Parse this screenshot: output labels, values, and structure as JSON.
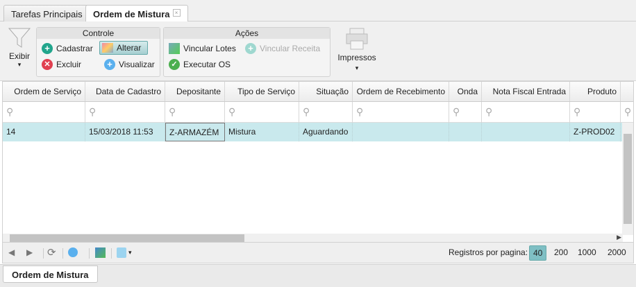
{
  "tabs": [
    {
      "label": "Tarefas Principais"
    },
    {
      "label": "Ordem de Mistura",
      "close": "×"
    }
  ],
  "toolbar": {
    "exibir": "Exibir",
    "controle": {
      "title": "Controle",
      "cadastrar": "Cadastrar",
      "alterar": "Alterar",
      "excluir": "Excluir",
      "visualizar": "Visualizar"
    },
    "acoes": {
      "title": "Ações",
      "vincular_lotes": "Vincular Lotes",
      "vincular_receita": "Vincular Receita",
      "executar_os": "Executar OS"
    },
    "impressos": "Impressos",
    "caret": "▾"
  },
  "grid": {
    "columns": [
      "Ordem de Serviço",
      "Data de Cadastro",
      "Depositante",
      "Tipo de Serviço",
      "Situação",
      "Ordem de Recebimento",
      "Onda",
      "Nota Fiscal Entrada",
      "Produto",
      ""
    ],
    "rows": [
      [
        "14",
        "15/03/2018 11:53",
        "Z-ARMAZÉM",
        "Mistura",
        "Aguardando",
        "",
        "",
        "",
        "Z-PROD02",
        ""
      ]
    ]
  },
  "pager": {
    "label": "Registros por pagina:",
    "sizes": [
      "40",
      "200",
      "1000",
      "2000"
    ],
    "selected": "40"
  },
  "bottom_tab": "Ordem de Mistura",
  "colors": {
    "selected_row": "#c9e9ed",
    "accent": "#7fbfc4"
  }
}
